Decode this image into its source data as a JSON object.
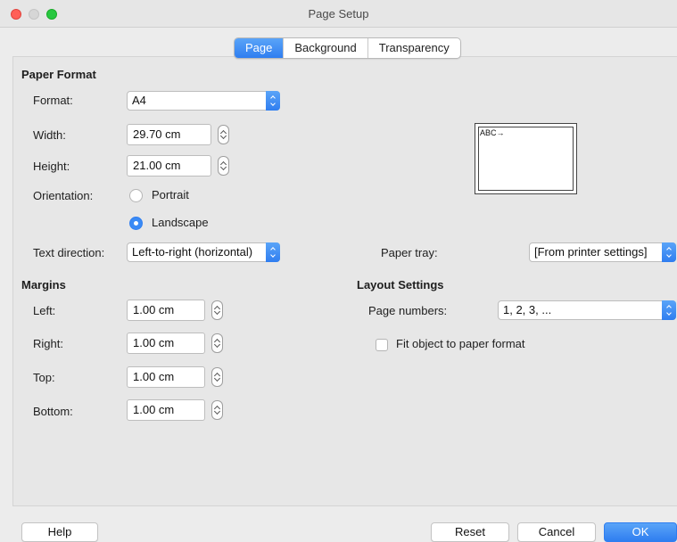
{
  "window": {
    "title": "Page Setup"
  },
  "tabs": [
    {
      "label": "Page",
      "active": true
    },
    {
      "label": "Background",
      "active": false
    },
    {
      "label": "Transparency",
      "active": false
    }
  ],
  "paper_format": {
    "heading": "Paper Format",
    "format_label": "Format:",
    "format_value": "A4",
    "width_label": "Width:",
    "width_value": "29.70 cm",
    "height_label": "Height:",
    "height_value": "21.00 cm",
    "orientation_label": "Orientation:",
    "portrait_label": "Portrait",
    "landscape_label": "Landscape",
    "orientation_selected": "Landscape",
    "text_direction_label": "Text direction:",
    "text_direction_value": "Left-to-right (horizontal)",
    "paper_tray_label": "Paper tray:",
    "paper_tray_value": "[From printer settings]",
    "preview_text": "ABC→"
  },
  "margins": {
    "heading": "Margins",
    "left_label": "Left:",
    "left_value": "1.00 cm",
    "right_label": "Right:",
    "right_value": "1.00 cm",
    "top_label": "Top:",
    "top_value": "1.00 cm",
    "bottom_label": "Bottom:",
    "bottom_value": "1.00 cm"
  },
  "layout_settings": {
    "heading": "Layout Settings",
    "page_numbers_label": "Page numbers:",
    "page_numbers_value": "1, 2, 3, ...",
    "fit_object_label": "Fit object to paper format",
    "fit_object_checked": false
  },
  "buttons": {
    "help": "Help",
    "reset": "Reset",
    "cancel": "Cancel",
    "ok": "OK"
  },
  "colors": {
    "accent": "#2f7ef0",
    "close": "#ff5f57",
    "zoom": "#28c840"
  }
}
